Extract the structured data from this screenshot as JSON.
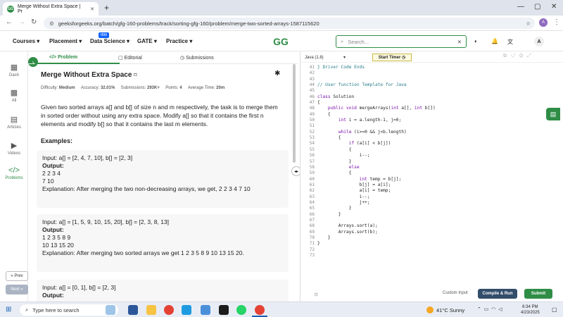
{
  "browser": {
    "tab_title": "Merge Without Extra Space | Pr",
    "url": "geeksforgeeks.org/batch/gfg-160-problems/track/sorting-gfg-160/problem/merge-two-sorted-arrays-1587115620"
  },
  "header": {
    "menu": [
      "Courses",
      "Placement",
      "Data Science",
      "GATE",
      "Practice"
    ],
    "badge": "IBM",
    "logo": "GG",
    "search_placeholder": "Search...",
    "avatar": "A"
  },
  "rail": {
    "items": [
      "Dash",
      "All",
      "Articles",
      "Videos",
      "Problems"
    ],
    "prev": "« Prev",
    "next": "Next »"
  },
  "problem_tabs": [
    "</> Problem",
    "Editorial",
    "Submissions"
  ],
  "problem": {
    "title": "Merge Without Extra Space",
    "difficulty_label": "Difficulty:",
    "difficulty": "Medium",
    "accuracy_label": "Accuracy:",
    "accuracy": "32.01%",
    "submissions_label": "Submissions:",
    "submissions": "293K+",
    "points_label": "Points:",
    "points": "4",
    "time_label": "Average Time:",
    "time": "20m",
    "description": "Given two sorted arrays a[] and b[] of size n and m respectively, the task is to merge them in sorted order without using any extra space. Modify a[] so that it contains the first n elements and modify b[] so that it contains the last m elements.",
    "examples_heading": "Examples:",
    "examples": [
      {
        "input": "Input: a[] = [2, 4, 7, 10], b[] = [2, 3]",
        "output_label": "Output:",
        "output1": "2 2 3 4",
        "output2": "7 10",
        "explanation": "Explanation: After merging the two non-decreasing arrays, we get, 2 2 3 4 7 10"
      },
      {
        "input": "Input: a[] = [1, 5, 9, 10, 15, 20], b[] = [2, 3, 8, 13]",
        "output_label": "Output:",
        "output1": "1 2 3 5 8 9",
        "output2": "10 13 15 20",
        "explanation": "Explanation: After merging two sorted arrays we get 1 2 3 5 8 9 10 13 15 20."
      },
      {
        "input": "Input: a[] = [0, 1], b[] = [2, 3]",
        "output_label": "Output:"
      }
    ]
  },
  "editor": {
    "language": "Java (1.8)",
    "timer": "Start Timer",
    "line_numbers": [
      "41",
      "42",
      "43",
      "44",
      "45",
      "46",
      "47",
      "48",
      "49",
      "50",
      "51",
      "52",
      "53",
      "54",
      "55",
      "56",
      "57",
      "58",
      "59",
      "60",
      "61",
      "62",
      "63",
      "64",
      "65",
      "66",
      "67",
      "68",
      "69",
      "70",
      "71",
      "72",
      "73"
    ],
    "code": [
      "} Driver Code Ends",
      "",
      "",
      "// User function Template for Java",
      "",
      "class Solution",
      "{",
      "    public void mergeArrays(int a[], int b[])",
      "    {",
      "        int i = a.length-1, j=0;",
      "",
      "        while (i>=0 && j<b.length)",
      "        {",
      "            if (a[i] < b[j])",
      "            {",
      "                i--;",
      "            }",
      "            else",
      "            {",
      "                int temp = b[j];",
      "                b[j] = a[i];",
      "                a[i] = temp;",
      "                i--;",
      "                j++;",
      "            }",
      "        }",
      "",
      "        Arrays.sort(a);",
      "        Arrays.sort(b);",
      "    }",
      "}",
      "",
      ""
    ],
    "custom_input": "Custom Input",
    "compile": "Compile & Run",
    "submit": "Submit"
  },
  "taskbar": {
    "search_placeholder": "Type here to search",
    "weather": "41°C  Sunny",
    "time": "6:34 PM",
    "date": "4/23/2025"
  }
}
